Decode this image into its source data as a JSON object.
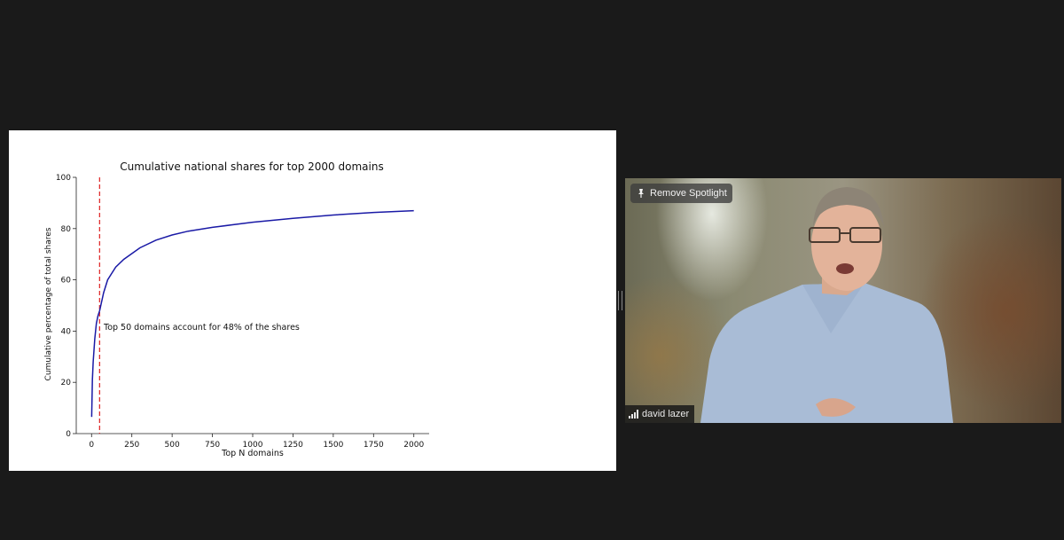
{
  "shared_screen": {
    "chart_data": {
      "type": "line",
      "title": "Cumulative national shares for top 2000 domains",
      "xlabel": "Top N domains",
      "ylabel": "Cumulative percentage of total shares",
      "xlim": [
        -95,
        2095
      ],
      "ylim": [
        0,
        100
      ],
      "x_ticks": [
        0,
        250,
        500,
        750,
        1000,
        1250,
        1500,
        1750,
        2000
      ],
      "y_ticks": [
        0,
        20,
        40,
        60,
        80,
        100
      ],
      "grid": false,
      "series": [
        {
          "color": "#1a1aa6",
          "x": [
            1,
            5,
            10,
            20,
            30,
            40,
            50,
            75,
            100,
            150,
            200,
            300,
            400,
            500,
            600,
            750,
            1000,
            1250,
            1500,
            1750,
            2000
          ],
          "y": [
            6.5,
            21,
            28,
            37,
            43,
            46,
            48,
            55,
            60,
            65,
            68,
            72.5,
            75.5,
            77.5,
            79,
            80.5,
            82.5,
            84,
            85.3,
            86.3,
            87
          ]
        }
      ],
      "vline": {
        "x": 50,
        "color": "#e03030",
        "style": "dashed"
      },
      "annotation": {
        "text": "Top 50 domains account for 48% of the shares",
        "x": 50,
        "y": 40
      }
    }
  },
  "video": {
    "spotlight_label": "Remove Spotlight",
    "participant_name": "david lazer"
  },
  "icons": {
    "pin": "pin-icon",
    "signal": "signal-icon"
  }
}
